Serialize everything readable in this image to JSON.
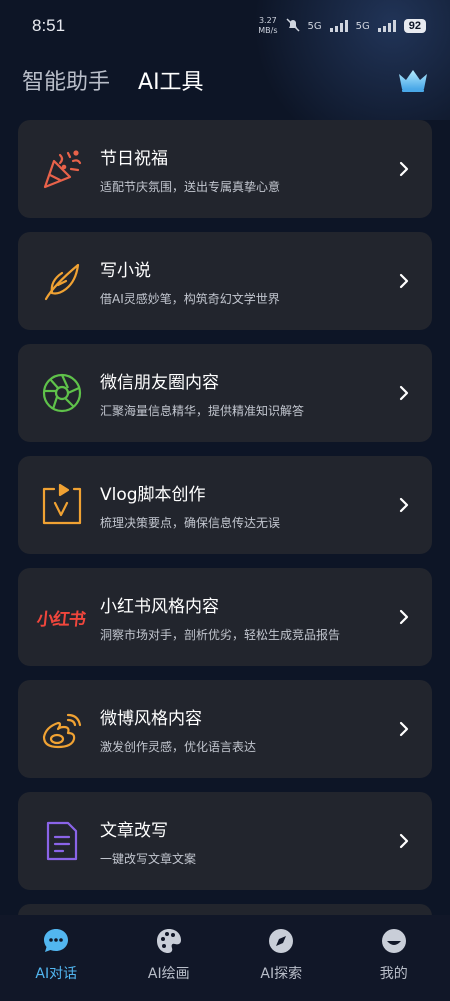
{
  "status": {
    "time": "8:51",
    "net_speed": "3.27",
    "net_unit": "MB/s",
    "sig1": "5G",
    "sig2": "5G",
    "battery": "92"
  },
  "header": {
    "tab_assistant": "智能助手",
    "tab_tools": "AI工具",
    "crown_icon": "crown-icon"
  },
  "cards": [
    {
      "title": "节日祝福",
      "desc": "适配节庆氛围，送出专属真挚心意",
      "icon": "party-popper-icon",
      "color": "#e8624a"
    },
    {
      "title": "写小说",
      "desc": "借AI灵感妙笔，构筑奇幻文学世界",
      "icon": "feather-icon",
      "color": "#f0a233"
    },
    {
      "title": "微信朋友圈内容",
      "desc": "汇聚海量信息精华，提供精准知识解答",
      "icon": "shutter-icon",
      "color": "#5fc24a"
    },
    {
      "title": "Vlog脚本创作",
      "desc": "梳理决策要点，确保信息传达无误",
      "icon": "vlog-icon",
      "color": "#f0a233"
    },
    {
      "title": "小红书风格内容",
      "desc": "洞察市场对手，剖析优劣，轻松生成竞品报告",
      "icon": "xiaohongshu-logo",
      "logo_text": "小红书",
      "color": "#f0463c"
    },
    {
      "title": "微博风格内容",
      "desc": "激发创作灵感，优化语言表达",
      "icon": "weibo-icon",
      "color": "#f0a233"
    },
    {
      "title": "文章改写",
      "desc": "一键改写文章文案",
      "icon": "document-icon",
      "color": "#8a64e8"
    }
  ],
  "tabbar": [
    {
      "label": "AI对话",
      "icon": "chat-bubble-icon",
      "active": true
    },
    {
      "label": "AI绘画",
      "icon": "palette-icon",
      "active": false
    },
    {
      "label": "AI探索",
      "icon": "compass-icon",
      "active": false
    },
    {
      "label": "我的",
      "icon": "smiley-icon",
      "active": false
    }
  ],
  "colors": {
    "accent": "#52b6f0",
    "background": "#0d1526",
    "card": "#22252d"
  }
}
